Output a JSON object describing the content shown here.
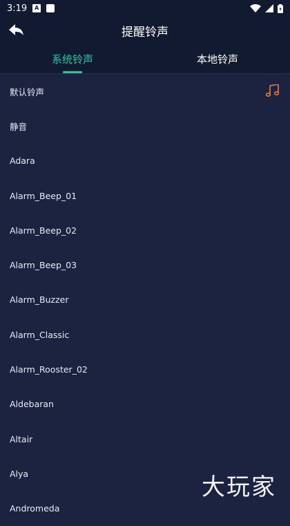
{
  "status": {
    "time": "3:19"
  },
  "header": {
    "title": "提醒铃声"
  },
  "tabs": [
    {
      "label": "系统铃声",
      "active": true
    },
    {
      "label": "本地铃声",
      "active": false
    }
  ],
  "ringtones": [
    "默认铃声",
    "静音",
    "Adara",
    "Alarm_Beep_01",
    "Alarm_Beep_02",
    "Alarm_Beep_03",
    "Alarm_Buzzer",
    "Alarm_Classic",
    "Alarm_Rooster_02",
    "Aldebaran",
    "Altair",
    "Alya",
    "Andromeda"
  ],
  "selected_index": 0,
  "accent_color": "#1fc9a3",
  "icon_color": "#e8813a",
  "watermark": "大玩家"
}
